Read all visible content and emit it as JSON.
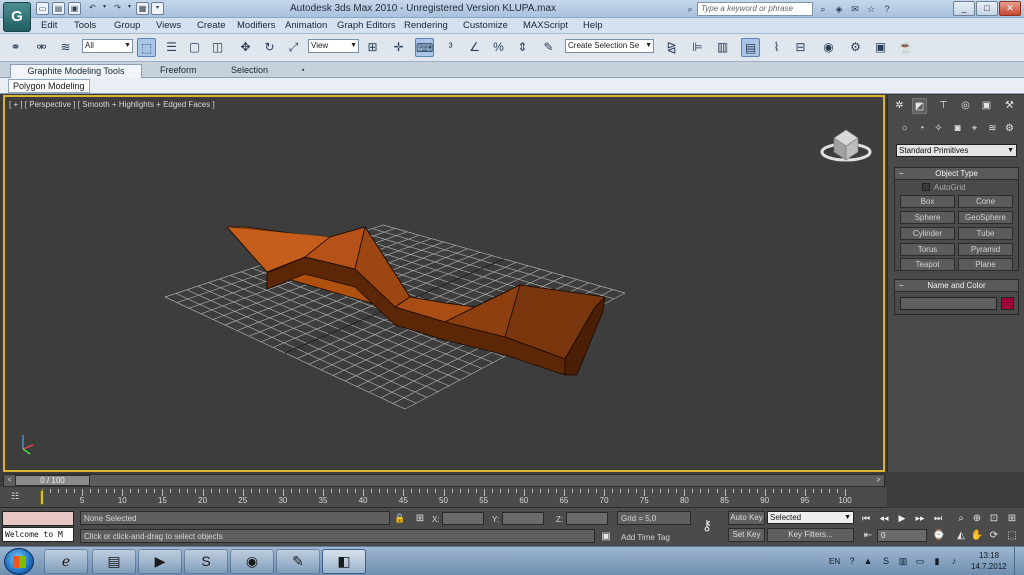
{
  "window": {
    "title": "Autodesk 3ds Max  2010   -  Unregistered Version    KLUPA.max",
    "search_placeholder": "Type a keyword or phrase",
    "logo_letter": "G"
  },
  "menu": [
    "Edit",
    "Tools",
    "Group",
    "Views",
    "Create",
    "Modifiers",
    "Animation",
    "Graph Editors",
    "Rendering",
    "Customize",
    "MAXScript",
    "Help"
  ],
  "toolbar": {
    "filter_value": "All",
    "ref_coord_value": "View",
    "named_selection_placeholder": "Create Selection Se"
  },
  "ribbon": {
    "tabs": [
      "Graphite Modeling Tools",
      "Freeform",
      "Selection"
    ],
    "subtab": "Polygon Modeling"
  },
  "viewport": {
    "label": "[ + ] [ Perspective ] [ Smooth + Highlights + Edged Faces ]",
    "object_color": "#b0500f",
    "grid_color": "#a8a8a8"
  },
  "command_panel": {
    "category_dropdown": "Standard Primitives",
    "object_type_title": "Object Type",
    "autogrid_label": "AutoGrid",
    "object_buttons": [
      "Box",
      "Cone",
      "Sphere",
      "GeoSphere",
      "Cylinder",
      "Tube",
      "Torus",
      "Pyramid",
      "Teapot",
      "Plane"
    ],
    "name_color_title": "Name and Color",
    "object_color": "#a0003a"
  },
  "timeline": {
    "slider_label": "0 / 100",
    "ticks": [
      0,
      5,
      10,
      15,
      20,
      25,
      30,
      35,
      40,
      45,
      50,
      55,
      60,
      65,
      70,
      75,
      80,
      85,
      90,
      95,
      100
    ],
    "current_frame": 0
  },
  "status": {
    "listener_text": "Welcome to M",
    "selection_status": "None Selected",
    "prompt": "Click or click-and-drag to select objects",
    "x_label": "X:",
    "y_label": "Y:",
    "z_label": "Z:",
    "grid_text": "Grid = 5,0",
    "add_time_tag": "Add Time Tag",
    "auto_key": "Auto Key",
    "set_key": "Set Key",
    "key_mode_value": "Selected",
    "key_filters": "Key Filters...",
    "frame_value": "0"
  },
  "taskbar": {
    "language": "EN",
    "time": "13:18",
    "date": "14.7.2012"
  }
}
